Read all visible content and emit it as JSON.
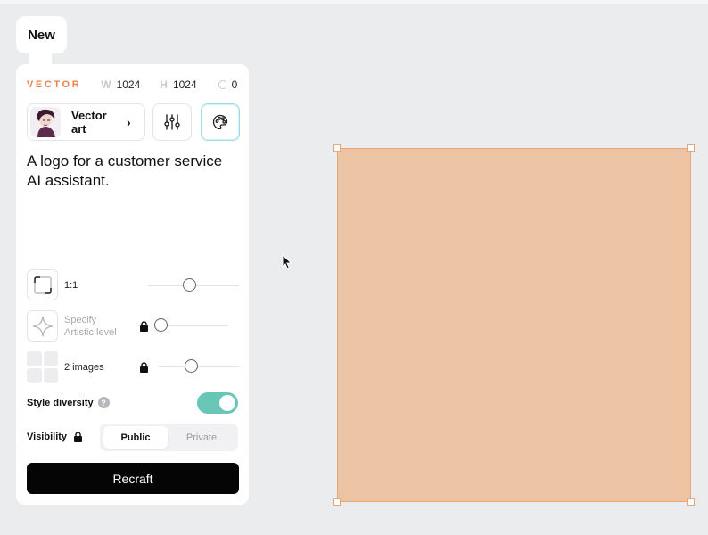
{
  "tab": {
    "label": "New"
  },
  "meta": {
    "mode": "VECTOR",
    "width_key": "W",
    "width_value": "1024",
    "height_key": "H",
    "height_value": "1024",
    "seed_value": "0"
  },
  "style": {
    "label": "Vector art"
  },
  "prompt": {
    "text": "A logo for a customer service AI assistant."
  },
  "aspect": {
    "label": "1:1",
    "level": 0.4
  },
  "artistic": {
    "label": "Specify Artistic level",
    "level": 0.0
  },
  "images": {
    "label": "2 images",
    "level": 0.3
  },
  "diversity": {
    "label": "Style diversity",
    "help": "?",
    "enabled": true
  },
  "visibility": {
    "label": "Visibility",
    "options": [
      "Public",
      "Private"
    ],
    "selected": "Public"
  },
  "action": {
    "label": "Recraft"
  },
  "colors": {
    "accent": "#e8844a",
    "toggle": "#68c6b6",
    "canvas_fill": "#ecc4a4",
    "canvas_border": "#e7a677"
  }
}
